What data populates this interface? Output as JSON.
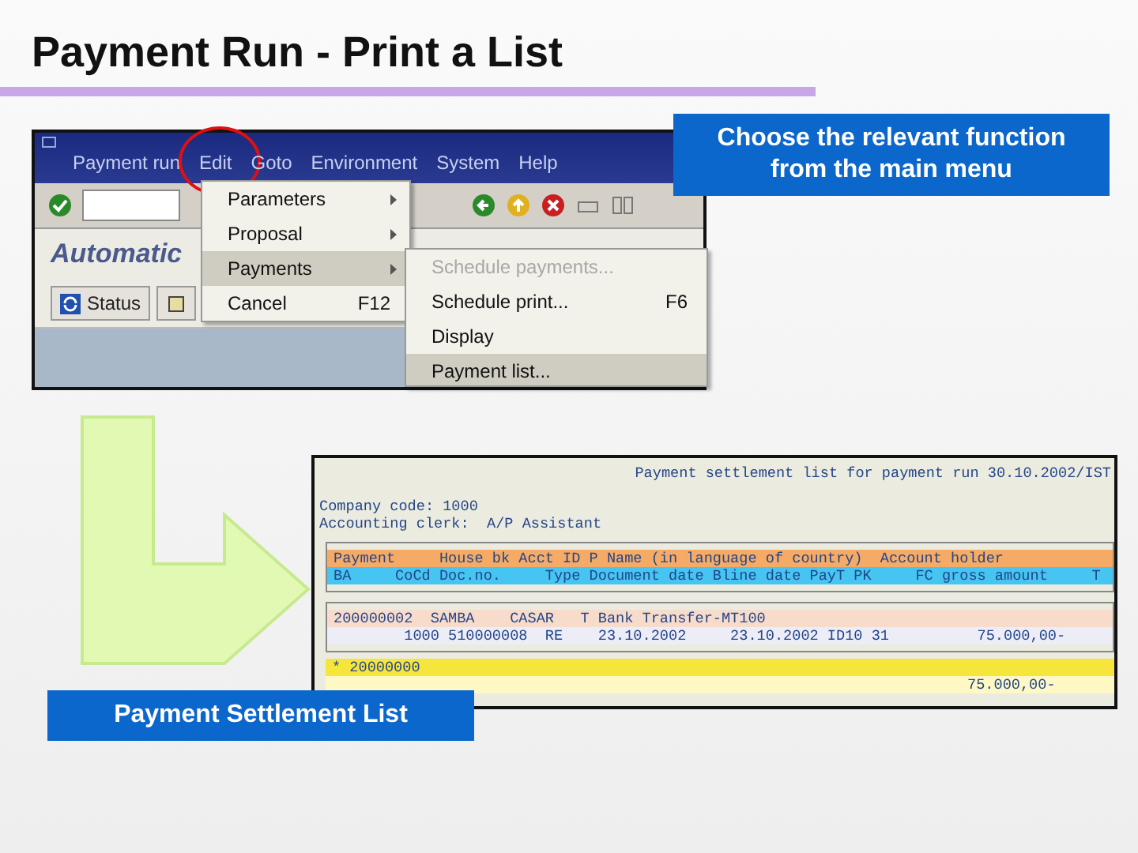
{
  "slide_title": "Payment Run - Print a List",
  "sap_window": {
    "menu_bar": [
      {
        "label": "Payment run",
        "highlighted": false
      },
      {
        "label": "Edit",
        "highlighted": true
      },
      {
        "label": "Goto",
        "highlighted": false
      },
      {
        "label": "Environment",
        "highlighted": false
      },
      {
        "label": "System",
        "highlighted": false
      },
      {
        "label": "Help",
        "highlighted": false
      }
    ],
    "screen_title": "Automatic",
    "status_button": "Status",
    "edit_menu": [
      {
        "label": "Parameters",
        "has_submenu": true,
        "selected": false
      },
      {
        "label": "Proposal",
        "has_submenu": true,
        "selected": false
      },
      {
        "label": "Payments",
        "has_submenu": true,
        "selected": true
      },
      {
        "label": "Cancel",
        "shortcut": "F12",
        "has_submenu": false,
        "selected": false
      }
    ],
    "payments_submenu": [
      {
        "label": "Schedule payments...",
        "disabled": true,
        "selected": false
      },
      {
        "label": "Schedule print...",
        "shortcut": "F6",
        "disabled": false,
        "selected": false
      },
      {
        "label": "Display",
        "disabled": false,
        "selected": false
      },
      {
        "label": "Payment list...",
        "disabled": false,
        "selected": true
      }
    ]
  },
  "callouts": [
    {
      "text": "Choose the relevant function from the main menu"
    },
    {
      "text": "Payment Settlement List"
    }
  ],
  "report": {
    "title": "Payment settlement list for payment run 30.10.2002/IST",
    "company_code": "Company code: 1000",
    "clerk": "Accounting clerk:  A/P Assistant",
    "header_lines": [
      {
        "kind": "primary",
        "text": "Payment     House bk Acct ID P Name (in language of country)  Account holder"
      },
      {
        "kind": "secondary",
        "text": "BA     CoCd Doc.no.     Type Document date Bline date PayT PK     FC gross amount     T"
      }
    ],
    "item_lines": [
      {
        "kind": "primary",
        "text": "200000002  SAMBA    CASAR   T Bank Transfer-MT100"
      },
      {
        "kind": "secondary",
        "text": "        1000 510000008  RE    23.10.2002     23.10.2002 ID10 31          75.000,00-"
      }
    ],
    "total_label": "* 20000000",
    "total_amount": "75.000,00-"
  }
}
